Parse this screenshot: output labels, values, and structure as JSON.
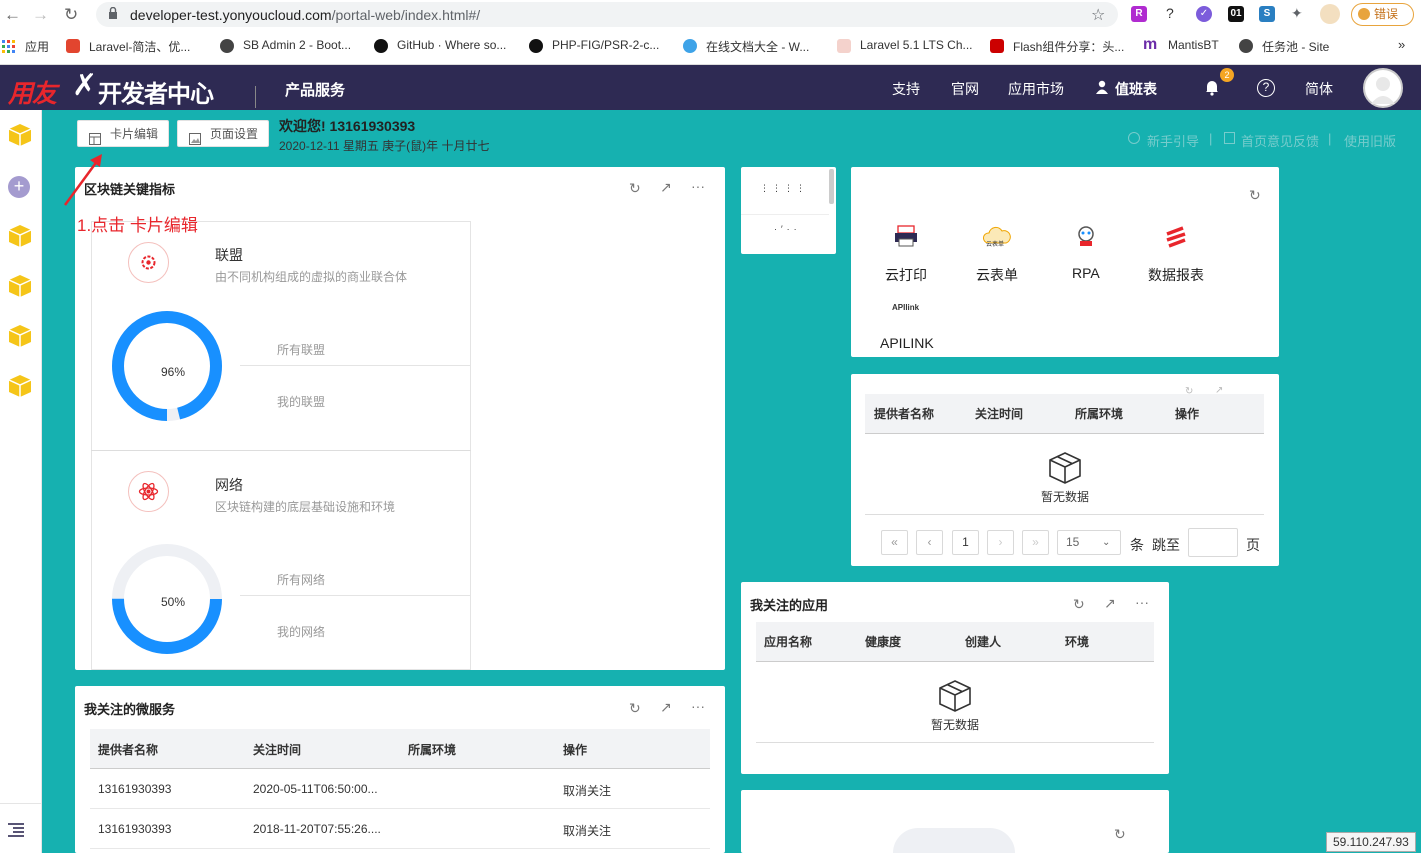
{
  "browser": {
    "url_host": "developer-test.yonyoucloud.com",
    "url_path": "/portal-web/index.html#/",
    "error_label": "错误",
    "bookmarks": [
      {
        "label": "应用"
      },
      {
        "label": "Laravel-简洁、优..."
      },
      {
        "label": "SB Admin 2 - Boot..."
      },
      {
        "label": "GitHub · Where so..."
      },
      {
        "label": "PHP-FIG/PSR-2-c..."
      },
      {
        "label": "在线文档大全 - W..."
      },
      {
        "label": "Laravel 5.1 LTS Ch..."
      },
      {
        "label": "Flash组件分享：头..."
      },
      {
        "label": "MantisBT"
      },
      {
        "label": "任务池 - Site"
      }
    ]
  },
  "header": {
    "logo_brand": "用友",
    "logo_text": "开发者中心",
    "product_menu": "产品服务",
    "nav": [
      "支持",
      "官网",
      "应用市场",
      "值班表"
    ],
    "notification_count": "2",
    "language": "简体"
  },
  "toolbar": {
    "card_edit_label": "卡片编辑",
    "page_settings_label": "页面设置",
    "welcome": "欢迎您!  13161930393",
    "date": "2020-12-11 星期五   庚子(鼠)年 十月廿七",
    "right_links": [
      "新手引导",
      "首页意见反馈",
      "使用旧版"
    ]
  },
  "annotation": "1.点击 卡片编辑",
  "blockchain_card": {
    "title": "区块链关键指标",
    "sections": [
      {
        "name": "联盟",
        "desc": "由不同机构组成的虚拟的商业联合体",
        "percent": 96,
        "percent_label": "96%",
        "stats": [
          "所有联盟",
          "我的联盟"
        ]
      },
      {
        "name": "网络",
        "desc": "区块链构建的底层基础设施和环境",
        "percent": 50,
        "percent_label": "50%",
        "stats": [
          "所有网络",
          "我的网络"
        ]
      }
    ]
  },
  "apps_card": {
    "apps": [
      {
        "label": "云打印"
      },
      {
        "label": "云表单"
      },
      {
        "label": "RPA"
      },
      {
        "label": "数据报表"
      },
      {
        "label": "APILINK"
      }
    ],
    "apilink_logo": "APIlink",
    "yunbiaodan_logo": "云表单"
  },
  "service_table_card": {
    "columns": [
      "提供者名称",
      "关注时间",
      "所属环境",
      "操作"
    ],
    "empty_text": "暂无数据",
    "pagination": {
      "page": "1",
      "page_size": "15",
      "items_label": "条",
      "jump_label": "跳至",
      "page_label": "页"
    }
  },
  "my_apps_card": {
    "title": "我关注的应用",
    "columns": [
      "应用名称",
      "健康度",
      "创建人",
      "环境"
    ],
    "empty_text": "暂无数据"
  },
  "microservices_card": {
    "title": "我关注的微服务",
    "columns": [
      "提供者名称",
      "关注时间",
      "所属环境",
      "操作"
    ],
    "rows": [
      {
        "provider": "13161930393",
        "time": "2020-05-11T06:50:00...",
        "env": "",
        "action": "取消关注"
      },
      {
        "provider": "13161930393",
        "time": "2018-11-20T07:55:26....",
        "env": "",
        "action": "取消关注"
      }
    ]
  },
  "ip_address": "59.110.247.93",
  "colors": {
    "teal": "#16b1b0",
    "header": "#2e2a53",
    "ring_blue": "#1890ff",
    "red": "#e8262c"
  }
}
